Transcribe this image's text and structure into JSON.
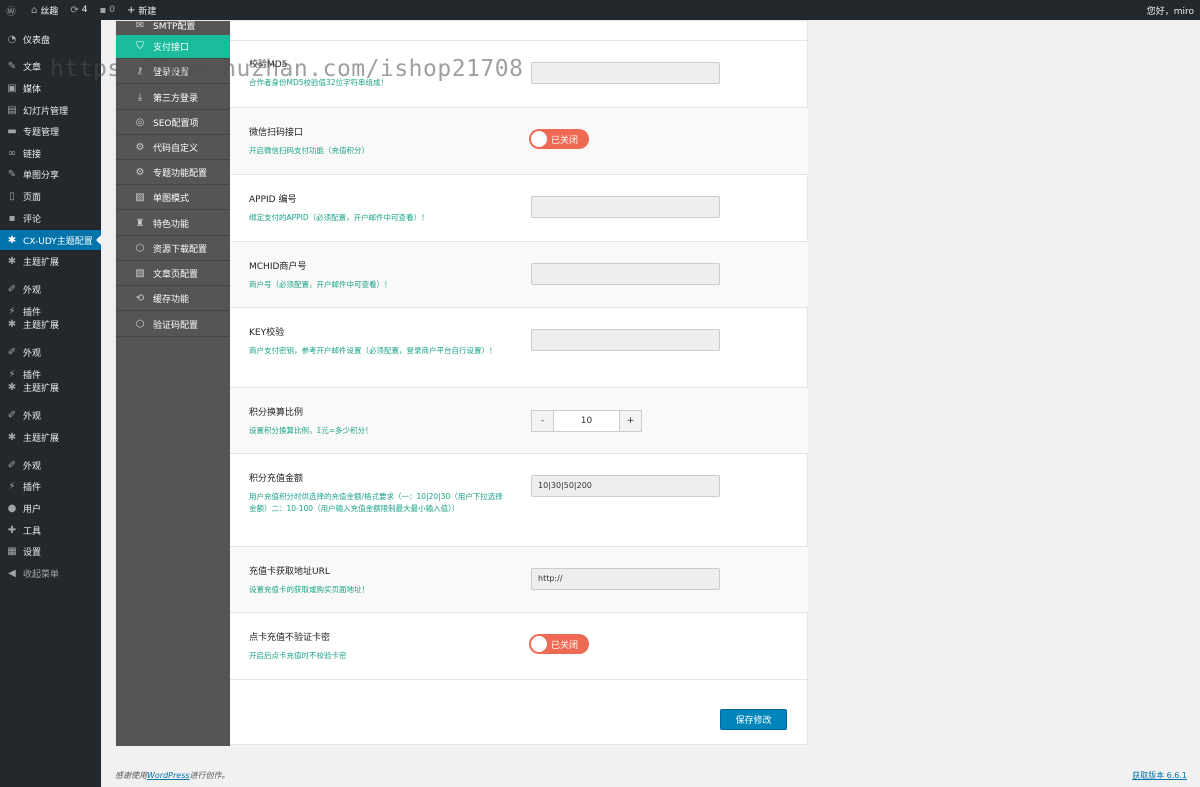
{
  "adminbar": {
    "site_name": "丝趣",
    "updates_count": "4",
    "comments_count": "0",
    "new_label": "新建",
    "greeting": "您好，miro"
  },
  "admin_menu": [
    {
      "label": "仪表盘",
      "icon": "dashboard-icon"
    },
    {
      "label": "文章",
      "icon": "pin-icon"
    },
    {
      "label": "媒体",
      "icon": "media-icon"
    },
    {
      "label": "幻灯片管理",
      "icon": "slides-icon"
    },
    {
      "label": "专题管理",
      "icon": "folder-icon"
    },
    {
      "label": "链接",
      "icon": "link-icon"
    },
    {
      "label": "单图分享",
      "icon": "pin-icon"
    },
    {
      "label": "页面",
      "icon": "page-icon"
    },
    {
      "label": "评论",
      "icon": "comment-icon"
    },
    {
      "label": "CX-UDY主题配置",
      "icon": "gear-icon",
      "active": true
    },
    {
      "label": "主题扩展",
      "icon": "gear-icon"
    },
    {
      "label": "外观",
      "icon": "brush-icon"
    },
    {
      "label": "插件",
      "icon": "plugin-icon"
    },
    {
      "label": "主题扩展",
      "icon": "gear-icon"
    },
    {
      "label": "外观",
      "icon": "brush-icon"
    },
    {
      "label": "插件",
      "icon": "plugin-icon"
    },
    {
      "label": "主题扩展",
      "icon": "gear-icon"
    },
    {
      "label": "外观",
      "icon": "brush-icon"
    },
    {
      "label": "主题扩展",
      "icon": "gear-icon"
    },
    {
      "label": "外观",
      "icon": "brush-icon"
    },
    {
      "label": "插件",
      "icon": "plugin-icon"
    },
    {
      "label": "用户",
      "icon": "user-icon"
    },
    {
      "label": "工具",
      "icon": "tools-icon"
    },
    {
      "label": "设置",
      "icon": "settings-icon"
    },
    {
      "label": "收起菜单",
      "icon": "collapse-icon"
    }
  ],
  "sub_menu": [
    {
      "label": "SMTP配置",
      "icon": "mail-icon"
    },
    {
      "label": "支付接口",
      "icon": "shield-icon",
      "active": true
    },
    {
      "label": "登录设置",
      "icon": "key-icon"
    },
    {
      "label": "第三方登录",
      "icon": "download-icon"
    },
    {
      "label": "SEO配置项",
      "icon": "seo-icon"
    },
    {
      "label": "代码自定义",
      "icon": "code-icon"
    },
    {
      "label": "专题功能配置",
      "icon": "feature-icon"
    },
    {
      "label": "单图模式",
      "icon": "image-icon"
    },
    {
      "label": "特色功能",
      "icon": "star-icon"
    },
    {
      "label": "资源下载配置",
      "icon": "download-icon"
    },
    {
      "label": "文章页配置",
      "icon": "document-icon"
    },
    {
      "label": "缓存功能",
      "icon": "cache-icon"
    },
    {
      "label": "验证码配置",
      "icon": "captcha-icon"
    }
  ],
  "settings": {
    "md5": {
      "title": "校验MD5",
      "desc": "合作者身份MD5校验值32位字符串组成！",
      "value": ""
    },
    "wechat_scan": {
      "title": "微信扫码接口",
      "desc": "开启微信扫码支付功能（充值积分）",
      "toggle_label": "已关闭"
    },
    "appid": {
      "title": "APPID 编号",
      "desc": "绑定支付的APPID（必须配置，开户邮件中可查看）！",
      "value": ""
    },
    "mchid": {
      "title": "MCHID商户号",
      "desc": "商户号（必须配置，开户邮件中可查看）！",
      "value": ""
    },
    "key": {
      "title": "KEY校验",
      "desc": "商户支付密钥，参考开户邮件设置（必须配置，登录商户平台自行设置）！",
      "value": ""
    },
    "ratio": {
      "title": "积分换算比例",
      "desc": "设置积分换算比例，1元=多少积分！",
      "minus": "-",
      "value": "10",
      "plus": "+"
    },
    "amounts": {
      "title": "积分充值金额",
      "desc": "用户充值积分时供选择的充值金额/格式要求（一：10|20|30（用户下拉选择金额）二：10-100（用户输入充值金额限制最大最小输入值））",
      "value": "10|30|50|200"
    },
    "card_url": {
      "title": "充值卡获取地址URL",
      "desc": "设置充值卡的获取或购买页面地址！",
      "value": "http://"
    },
    "card_verify": {
      "title": "点卡充值不验证卡密",
      "desc": "开启后点卡充值时不校验卡密",
      "toggle_label": "已关闭"
    }
  },
  "save_label": "保存修改",
  "footer": {
    "thanks_prefix": "感谢使用",
    "wordpress": "WordPress",
    "thanks_suffix": "进行创作。",
    "version": "获取版本 6.6.1"
  },
  "watermark": "https://www.huzhan.com/ishop21708",
  "colors": {
    "admin_bg": "#23282d",
    "active_menu": "#0073aa",
    "sub_active": "#1abc9c",
    "toggle_off": "#ee6a55",
    "desc_text": "#1aa289",
    "save_button": "#0085ba"
  }
}
